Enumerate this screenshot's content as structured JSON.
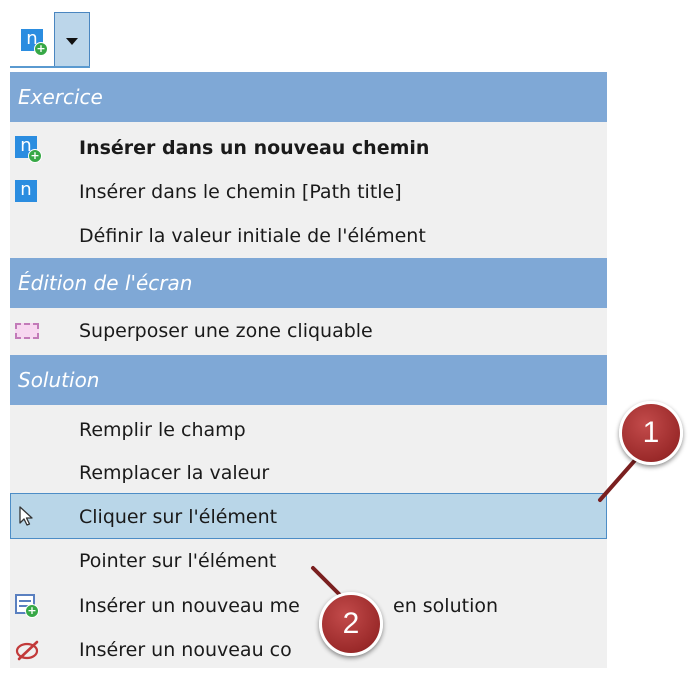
{
  "toolbar": {
    "main_icon": "new-path-insert-icon",
    "dropdown_icon": "chevron-down-icon"
  },
  "menu": {
    "sections": [
      {
        "title": "Exercice",
        "items": [
          {
            "label": "Insérer dans un nouveau chemin",
            "bold": true,
            "icon": "new-path-insert-icon"
          },
          {
            "label": "Insérer dans le chemin [Path title]",
            "icon": "path-insert-icon"
          },
          {
            "label": "Définir la valeur initiale de l'élément",
            "icon": ""
          }
        ]
      },
      {
        "title": "Édition de l'écran",
        "items": [
          {
            "label": "Superposer une zone cliquable",
            "icon": "clickable-zone-icon"
          }
        ]
      },
      {
        "title": "Solution",
        "items": [
          {
            "label": "Remplir le champ",
            "icon": ""
          },
          {
            "label": "Remplacer la valeur",
            "icon": ""
          },
          {
            "label": "Cliquer sur l'élément",
            "icon": "cursor-icon",
            "selected": true
          },
          {
            "label": "Pointer sur l'élément",
            "icon": ""
          },
          {
            "label": "Insérer un nouveau me",
            "icon": "new-message-icon"
          },
          {
            "label": "en solution",
            "icon": ""
          },
          {
            "label": "Insérer un nouveau co",
            "icon": "comment-pen-icon"
          }
        ]
      }
    ]
  },
  "callouts": [
    {
      "number": "1"
    },
    {
      "number": "2"
    }
  ],
  "colors": {
    "section_header": "#7fa8d6",
    "selected_bg": "#b9d6e8",
    "selected_border": "#4d8dc6",
    "callout": "#9b2a2a"
  }
}
